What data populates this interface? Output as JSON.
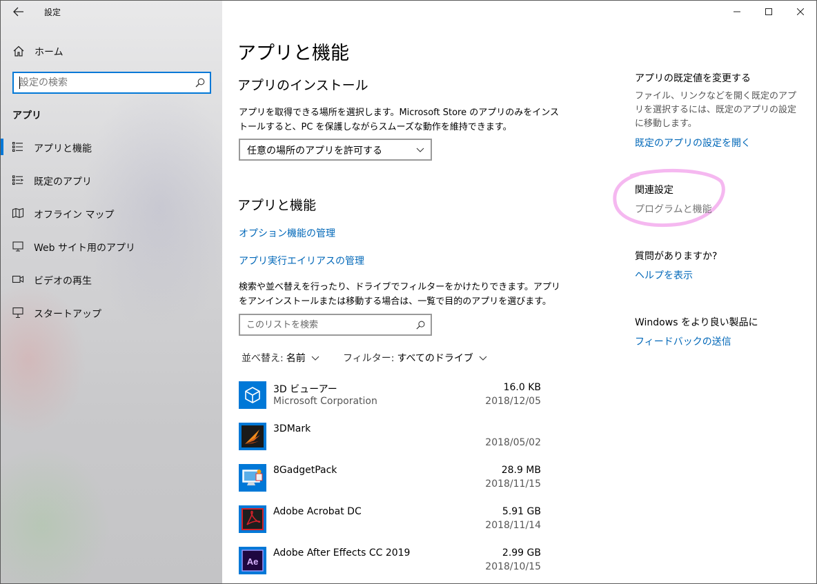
{
  "window": {
    "title": "設定",
    "controls": {
      "minimize_icon": "minimize-icon",
      "maximize_icon": "maximize-icon",
      "close_icon": "close-icon"
    }
  },
  "sidebar": {
    "home_label": "ホーム",
    "search_placeholder": "設定の検索",
    "section_heading": "アプリ",
    "items": [
      {
        "label": "アプリと機能",
        "icon": "apps-features-icon",
        "active": true
      },
      {
        "label": "既定のアプリ",
        "icon": "default-apps-icon",
        "active": false
      },
      {
        "label": "オフライン マップ",
        "icon": "offline-maps-icon",
        "active": false
      },
      {
        "label": "Web サイト用のアプリ",
        "icon": "apps-for-websites-icon",
        "active": false
      },
      {
        "label": "ビデオの再生",
        "icon": "video-playback-icon",
        "active": false
      },
      {
        "label": "スタートアップ",
        "icon": "startup-icon",
        "active": false
      }
    ]
  },
  "main": {
    "page_title": "アプリと機能",
    "install": {
      "heading": "アプリのインストール",
      "description": "アプリを取得できる場所を選択します。Microsoft Store のアプリのみをインストールすると、PC を保護しながらスムーズな動作を維持できます。",
      "dropdown_value": "任意の場所のアプリを許可する"
    },
    "features": {
      "heading": "アプリと機能",
      "link_optional": "オプション機能の管理",
      "link_alias": "アプリ実行エイリアスの管理",
      "description": "検索や並べ替えを行ったり、ドライブでフィルターをかけたりできます。アプリをアンインストールまたは移動する場合は、一覧で目的のアプリを選びます。",
      "list_search_placeholder": "このリストを検索",
      "sort_label": "並べ替え:",
      "sort_value": "名前",
      "filter_label": "フィルター:",
      "filter_value": "すべてのドライブ"
    },
    "apps": [
      {
        "name": "3D ビューアー",
        "publisher": "Microsoft Corporation",
        "size": "16.0 KB",
        "date": "2018/12/05",
        "icon": "3d-viewer-icon",
        "tile_color": "#0078d7"
      },
      {
        "name": "3DMark",
        "publisher": "",
        "size": "",
        "date": "2018/05/02",
        "icon": "3dmark-icon",
        "tile_color": "#1a1a1a"
      },
      {
        "name": "8GadgetPack",
        "publisher": "",
        "size": "28.9 MB",
        "date": "2018/11/15",
        "icon": "8gadgetpack-icon",
        "tile_color": "#0078d7"
      },
      {
        "name": "Adobe Acrobat DC",
        "publisher": "",
        "size": "5.91 GB",
        "date": "2018/11/14",
        "icon": "adobe-acrobat-icon",
        "tile_color": "#0078d7"
      },
      {
        "name": "Adobe After Effects CC 2019",
        "publisher": "",
        "size": "2.99 GB",
        "date": "2018/10/15",
        "icon": "after-effects-icon",
        "tile_color": "#0078d7"
      }
    ]
  },
  "right": {
    "defaults_heading": "アプリの既定値を変更する",
    "defaults_desc": "ファイル、リンクなどを開く既定のアプリを選択するには、既定のアプリの設定に移動します。",
    "defaults_link": "既定のアプリの設定を開く",
    "related_heading": "関連設定",
    "related_item": "プログラムと機能",
    "question_heading": "質問がありますか?",
    "help_link": "ヘルプを表示",
    "feedback_heading": "Windows をより良い製品に",
    "feedback_link": "フィードバックの送信",
    "highlight_color": "#f5b8f0"
  },
  "colors": {
    "accent": "#0078d7",
    "link": "#0067b8"
  }
}
